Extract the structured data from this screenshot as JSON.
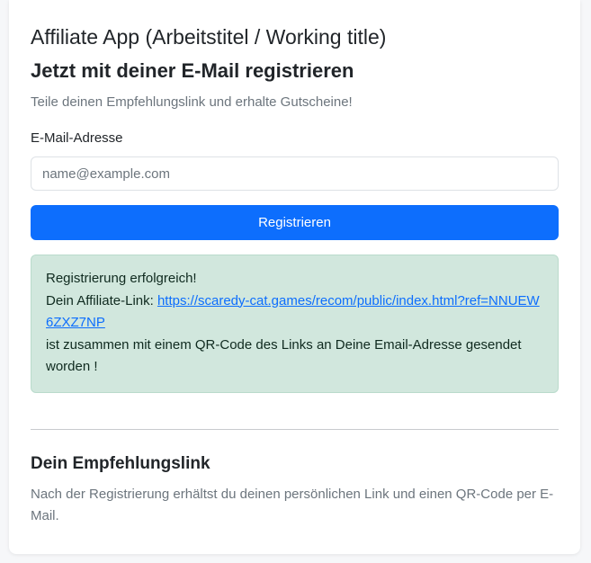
{
  "header": {
    "app_title": "Affiliate App (Arbeitstitel / Working title)",
    "subtitle": "Jetzt mit deiner E-Mail registrieren",
    "lead": "Teile deinen Empfehlungslink und erhalte Gutscheine!"
  },
  "form": {
    "email_label": "E-Mail-Adresse",
    "email_value": "",
    "email_placeholder": "name@example.com",
    "submit_label": "Registrieren"
  },
  "alert": {
    "line1": "Registrierung erfolgreich!",
    "link_prefix": "Dein Affiliate-Link: ",
    "link_text": "https://scaredy-cat.games/recom/public/index.html?ref=NNUEW6ZXZ7NP",
    "line3": "ist zusammen mit einem QR-Code des Links an Deine Email-Adresse gesendet worden !"
  },
  "info": {
    "title": "Dein Empfehlungslink",
    "text": "Nach der Registrierung erhältst du deinen persönlichen Link und einen QR-Code per E-Mail."
  },
  "colors": {
    "primary": "#0d6efd",
    "alert_bg": "#d1e7dd",
    "alert_border": "#badbcc",
    "muted_text": "#6c757d"
  }
}
